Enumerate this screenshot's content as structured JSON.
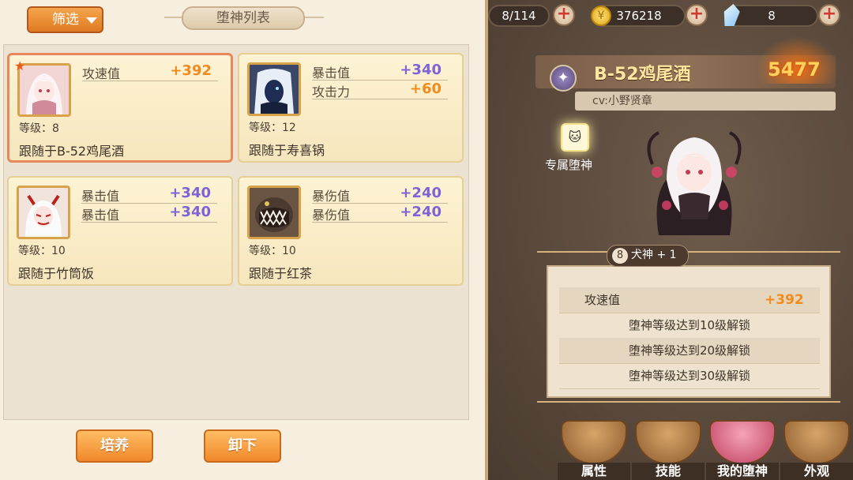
{
  "left_panel": {
    "filter_label": "筛选",
    "list_title": "堕神列表",
    "cards": [
      {
        "selected": true,
        "starred": true,
        "portrait_icon": "white-hair-girl-portrait",
        "stats": [
          {
            "name": "攻速值",
            "value": "+392",
            "color": "orange"
          }
        ],
        "level": "等级：8",
        "follow": "跟随于B-52鸡尾酒"
      },
      {
        "selected": false,
        "starred": false,
        "portrait_icon": "dark-blue-spirit-portrait",
        "stats": [
          {
            "name": "暴击值",
            "value": "+340",
            "color": "purple"
          },
          {
            "name": "攻击力",
            "value": "+60",
            "color": "orange"
          }
        ],
        "level": "等级：12",
        "follow": "跟随于寿喜锅"
      },
      {
        "selected": false,
        "starred": false,
        "portrait_icon": "horned-white-demon-portrait",
        "stats": [
          {
            "name": "暴击值",
            "value": "+340",
            "color": "purple"
          },
          {
            "name": "暴击值",
            "value": "+340",
            "color": "purple"
          }
        ],
        "level": "等级：10",
        "follow": "跟随于竹筒饭"
      },
      {
        "selected": false,
        "starred": false,
        "portrait_icon": "toothy-monster-portrait",
        "stats": [
          {
            "name": "暴伤值",
            "value": "+240",
            "color": "purple"
          },
          {
            "name": "暴伤值",
            "value": "+240",
            "color": "purple"
          }
        ],
        "level": "等级：10",
        "follow": "跟随于红茶"
      }
    ],
    "buttons": {
      "cultivate": "培养",
      "unequip": "卸下"
    }
  },
  "right_panel": {
    "resources": {
      "stamina": "8/114",
      "gold": "376218",
      "gems": "8"
    },
    "character_name": "B-52鸡尾酒",
    "power": "5477",
    "cv": "cv:小野贤章",
    "exclusive_label": "专属堕神",
    "dog_badge": {
      "level": "8",
      "text": "犬神 + 1"
    },
    "info_rows": [
      {
        "name": "攻速值",
        "value": "+392"
      },
      {
        "text": "堕神等级达到10级解锁"
      },
      {
        "text": "堕神等级达到20级解锁"
      },
      {
        "text": "堕神等级达到30级解锁"
      }
    ],
    "nav": [
      {
        "label": "属性",
        "icon": "duck-bowl-icon"
      },
      {
        "label": "技能",
        "icon": "crab-bowl-icon"
      },
      {
        "label": "我的堕神",
        "icon": "spirit-bowl-icon",
        "active": true
      },
      {
        "label": "外观",
        "icon": "duck-family-bowl-icon"
      }
    ]
  },
  "colors": {
    "accent_orange": "#f28a1e",
    "accent_purple": "#7d63d6",
    "selected_border": "#e8875a"
  }
}
